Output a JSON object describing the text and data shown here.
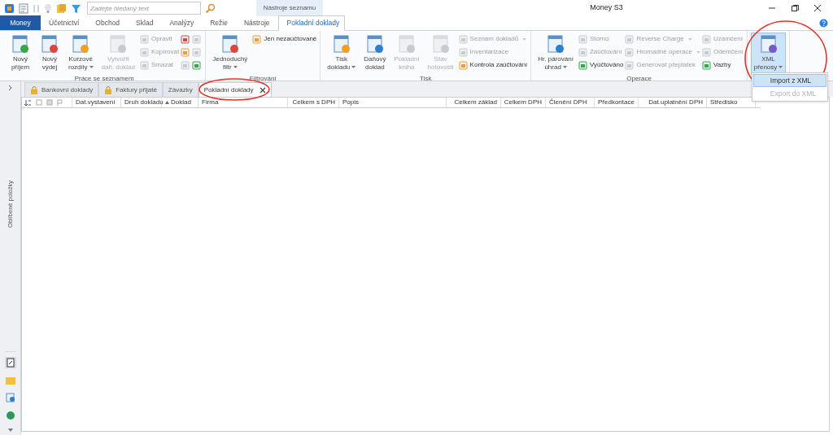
{
  "title_bar": {
    "search_placeholder": "Zadejte hledaný text",
    "context_group": "Nástroje seznamu",
    "title": "Money S3"
  },
  "ribbon_tabs": [
    {
      "label": "Money",
      "kind": "app",
      "selected": false
    },
    {
      "label": "Účetnictví",
      "kind": "tab",
      "selected": false
    },
    {
      "label": "Obchod",
      "kind": "tab",
      "selected": false
    },
    {
      "label": "Sklad",
      "kind": "tab",
      "selected": false
    },
    {
      "label": "Analýzy",
      "kind": "tab",
      "selected": false
    },
    {
      "label": "Režie",
      "kind": "tab",
      "selected": false
    },
    {
      "label": "Nástroje",
      "kind": "tab",
      "selected": false
    },
    {
      "label": "Pokladní doklady",
      "kind": "tab",
      "selected": true
    }
  ],
  "ribbon_groups": [
    {
      "label": "Práce se seznamem",
      "items": [
        {
          "kind": "large",
          "lines": [
            "Nový",
            "příjem"
          ],
          "disabled": false,
          "dropdown": false
        },
        {
          "kind": "large",
          "lines": [
            "Nový",
            "výdej"
          ],
          "disabled": false,
          "dropdown": false
        },
        {
          "kind": "large",
          "lines": [
            "Kurzové",
            "rozdíly"
          ],
          "disabled": false,
          "dropdown": true
        },
        {
          "kind": "large",
          "lines": [
            "Vytvořit",
            "daň. doklad"
          ],
          "disabled": true,
          "dropdown": false
        },
        {
          "kind": "small",
          "label": "Opravit",
          "disabled": true,
          "dropdown": false
        },
        {
          "kind": "small",
          "label": "Kopírovat",
          "disabled": true,
          "dropdown": false
        },
        {
          "kind": "small",
          "label": "Smazat",
          "disabled": true,
          "dropdown": false
        },
        {
          "kind": "icon",
          "disabled": false
        },
        {
          "kind": "icon",
          "disabled": false
        },
        {
          "kind": "icon",
          "disabled": true
        },
        {
          "kind": "icon",
          "disabled": true
        },
        {
          "kind": "icon",
          "disabled": true
        },
        {
          "kind": "icon",
          "disabled": false
        }
      ]
    },
    {
      "label": "Filtrování",
      "items": [
        {
          "kind": "large",
          "lines": [
            "Jednoduchý",
            "filtr"
          ],
          "disabled": false,
          "dropdown": true
        },
        {
          "kind": "small",
          "label": "Jen nezaúčtované",
          "disabled": false,
          "dropdown": false
        }
      ]
    },
    {
      "label": "Tisk",
      "items": [
        {
          "kind": "large",
          "lines": [
            "Tisk",
            "dokladu"
          ],
          "disabled": false,
          "dropdown": true
        },
        {
          "kind": "large",
          "lines": [
            "Daňový",
            "doklad"
          ],
          "disabled": false,
          "dropdown": false
        },
        {
          "kind": "large",
          "lines": [
            "Pokladní",
            "kniha"
          ],
          "disabled": true,
          "dropdown": false
        },
        {
          "kind": "large",
          "lines": [
            "Stav",
            "hotovosti"
          ],
          "disabled": true,
          "dropdown": false
        },
        {
          "kind": "small",
          "label": "Seznam dokladů",
          "disabled": true,
          "dropdown": true
        },
        {
          "kind": "small",
          "label": "Inventarizace",
          "disabled": true,
          "dropdown": false
        },
        {
          "kind": "small",
          "label": "Kontrola zaúčtování",
          "disabled": false,
          "dropdown": false
        }
      ]
    },
    {
      "label": "Operace",
      "items": [
        {
          "kind": "large",
          "lines": [
            "Hr. párování",
            "úhrad"
          ],
          "disabled": false,
          "dropdown": true
        },
        {
          "kind": "small",
          "label": "Storno",
          "disabled": true,
          "dropdown": false
        },
        {
          "kind": "small",
          "label": "Zaúčtování",
          "disabled": true,
          "dropdown": false
        },
        {
          "kind": "small",
          "label": "Vyúčtováno",
          "disabled": false,
          "dropdown": false
        },
        {
          "kind": "small",
          "label": "Reverse Charge",
          "disabled": true,
          "dropdown": true
        },
        {
          "kind": "small",
          "label": "Hromadné operace",
          "disabled": true,
          "dropdown": true
        },
        {
          "kind": "small",
          "label": "Generovat přeplatek",
          "disabled": true,
          "dropdown": false
        },
        {
          "kind": "small",
          "label": "Uzamčení",
          "disabled": true,
          "dropdown": false
        },
        {
          "kind": "small",
          "label": "Odemčení",
          "disabled": true,
          "dropdown": false
        },
        {
          "kind": "small",
          "label": "Vazby",
          "disabled": false,
          "dropdown": false
        }
      ]
    },
    {
      "items": [
        {
          "kind": "large",
          "lines": [
            "XML",
            "přenosy"
          ],
          "disabled": false,
          "dropdown": true,
          "pressed": true,
          "menu": [
            {
              "label": "Import z XML",
              "selected": true,
              "disabled": false
            },
            {
              "label": "Export do XML",
              "selected": false,
              "disabled": true
            }
          ]
        }
      ]
    }
  ],
  "document_tabs": [
    {
      "label": "Bankovní doklady",
      "locked": true,
      "selected": false
    },
    {
      "label": "Faktury přijaté",
      "locked": true,
      "selected": false
    },
    {
      "label": "Závazky",
      "locked": false,
      "selected": false
    },
    {
      "label": "Pokladní doklady",
      "locked": false,
      "selected": true
    }
  ],
  "table": {
    "columns": [
      {
        "label": "Dat.vystavení"
      },
      {
        "label": "Druh dokladu"
      },
      {
        "label": "Doklad",
        "sorted": true
      },
      {
        "label": "Firma"
      },
      {
        "label": "Celkem s DPH"
      },
      {
        "label": "Popis"
      },
      {
        "label": "Celkem základ"
      },
      {
        "label": "Celkem DPH"
      },
      {
        "label": "Členění DPH"
      },
      {
        "label": "Předkontace"
      },
      {
        "label": "Dat.uplatnění DPH"
      },
      {
        "label": "Středisko"
      }
    ]
  },
  "sidebar": {
    "label": "Oblíbené položky"
  }
}
